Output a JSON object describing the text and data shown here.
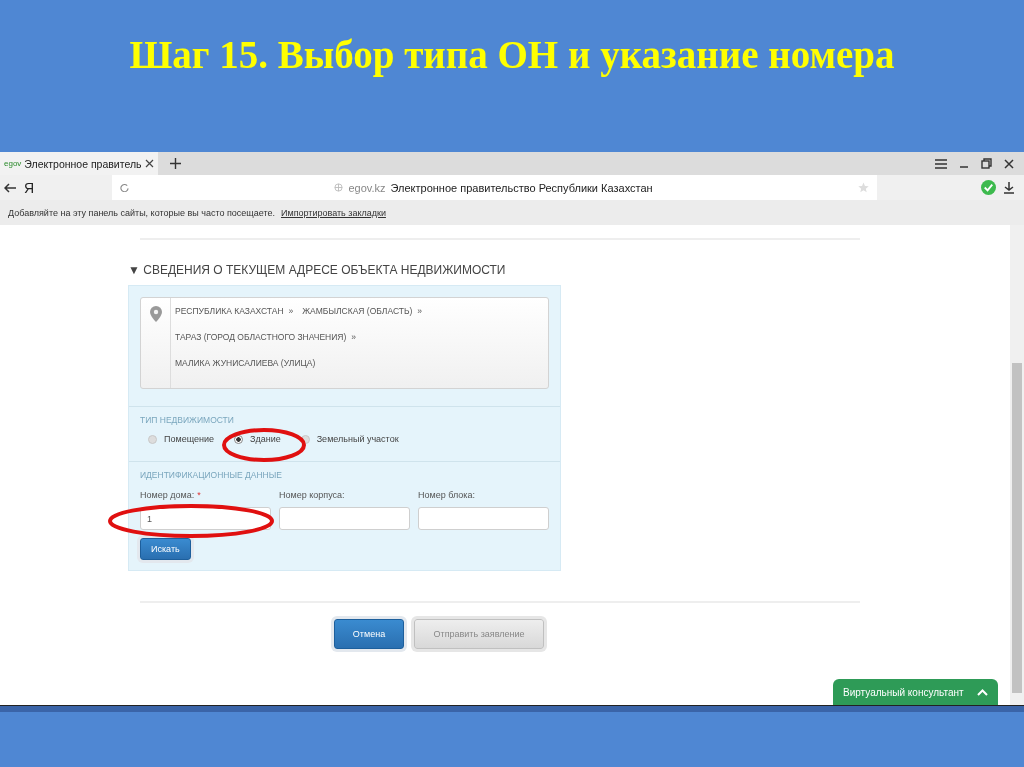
{
  "slide_title": "Шаг 15. Выбор типа ОН и указание номера",
  "browser": {
    "tab": {
      "favicon": "egov",
      "title": "Электронное правитель"
    },
    "toolbar_logo": "Я",
    "address_bar": {
      "domain": "egov.kz",
      "page_title": "Электронное правительство Республики Казахстан"
    },
    "bookmarks_bar": {
      "text": "Добавляйте на эту панель сайты, которые вы часто посещаете.",
      "link": "Импортировать закладки"
    }
  },
  "page": {
    "section_title": "▼ СВЕДЕНИЯ О ТЕКУЩЕМ АДРЕСЕ ОБЪЕКТА НЕДВИЖИМОСТИ",
    "address_lines": [
      [
        {
          "text": "РЕСПУБЛИКА КАЗАХСТАН",
          "separator": "»"
        },
        {
          "text": "ЖАМБЫЛСКАЯ (ОБЛАСТЬ)",
          "separator": "»"
        }
      ],
      [
        {
          "text": "ТАРАЗ (ГОРОД ОБЛАСТНОГО ЗНАЧЕНИЯ)",
          "separator": "»"
        }
      ],
      [
        {
          "text": "МАЛИКА ЖУНИСАЛИЕВА (УЛИЦА)"
        }
      ]
    ],
    "property_type": {
      "label": "ТИП НЕДВИЖИМОСТИ",
      "options": [
        {
          "label": "Помещение",
          "selected": false
        },
        {
          "label": "Здание",
          "selected": true
        },
        {
          "label": "Земельный участок",
          "selected": false
        }
      ]
    },
    "identification": {
      "label": "ИДЕНТИФИКАЦИОННЫЕ ДАННЫЕ",
      "fields": [
        {
          "label": "Номер дома:",
          "required_mark": "*",
          "value": "1"
        },
        {
          "label": "Номер корпуса:"
        },
        {
          "label": "Номер блока:"
        }
      ]
    },
    "search_button": "Искать",
    "cancel_button": "Отмена",
    "submit_button": {
      "label": "Отправить заявление",
      "disabled": true
    },
    "consultant": "Виртуальный консультант"
  }
}
